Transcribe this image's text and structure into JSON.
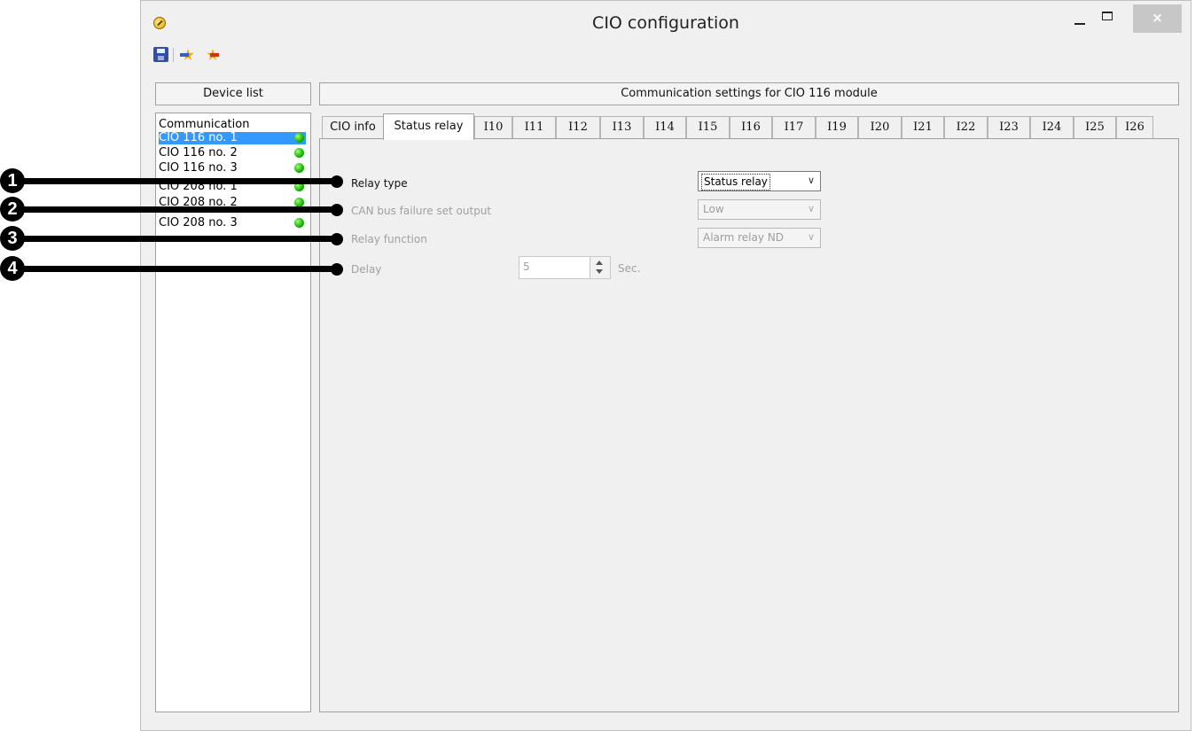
{
  "window": {
    "title": "CIO configuration",
    "close_glyph": "×"
  },
  "toolbar": {
    "icons": [
      "save-icon",
      "read-config-icon",
      "write-config-icon"
    ]
  },
  "device_list": {
    "header": "Device list",
    "items": [
      {
        "label": "Communication",
        "status": null,
        "selected": false
      },
      {
        "label": "CIO 116 no. 1",
        "status": "green",
        "selected": true
      },
      {
        "label": "CIO 116 no. 2",
        "status": "green",
        "selected": false
      },
      {
        "label": "CIO 116 no. 3",
        "status": "green",
        "selected": false
      },
      {
        "label": "CIO 208 no. 1",
        "status": "green",
        "selected": false
      },
      {
        "label": "CIO 208 no. 2",
        "status": "green",
        "selected": false
      },
      {
        "label": "CIO 208 no. 3",
        "status": "green",
        "selected": false
      }
    ]
  },
  "settings": {
    "header": "Communication settings for CIO 116 module",
    "tabs": [
      "CIO info",
      "Status relay",
      "I10",
      "I11",
      "I12",
      "I13",
      "I14",
      "I15",
      "I16",
      "I17",
      "I19",
      "I20",
      "I21",
      "I22",
      "I23",
      "I24",
      "I25",
      "I26"
    ],
    "active_tab": "Status relay",
    "fields": {
      "relay_type": {
        "label": "Relay type",
        "value": "Status relay",
        "enabled": true
      },
      "can_bus_failure": {
        "label": "CAN bus failure set output",
        "value": "Low",
        "enabled": false
      },
      "relay_function": {
        "label": "Relay function",
        "value": "Alarm relay ND",
        "enabled": false
      },
      "delay": {
        "label": "Delay",
        "value": "5",
        "unit": "Sec.",
        "enabled": false
      }
    },
    "chevron": "∨"
  },
  "callouts": [
    "1",
    "2",
    "3",
    "4"
  ],
  "colors": {
    "selection": "#3399ff",
    "status_ok": "#13b300",
    "callout": "#000000"
  }
}
